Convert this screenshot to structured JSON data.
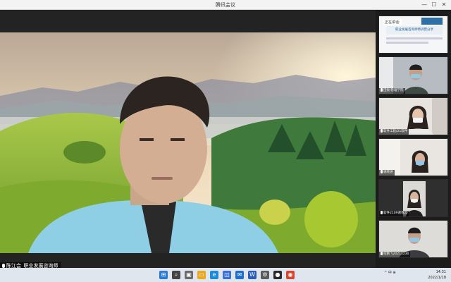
{
  "window": {
    "title": "腾讯会议",
    "min": "—",
    "max": "☐",
    "close": "✕"
  },
  "main": {
    "speaker_label": "陈江会_职业发展咨询师",
    "colors": {
      "sky_top": "#c9b7a3",
      "sky_bottom": "#f3e2c4",
      "hill_green": "#8fba3a",
      "forest": "#2e6b3a",
      "shirt": "#8fcfe6"
    }
  },
  "side": {
    "share_tile": {
      "top_text": "正在讲话:",
      "banner": "职业发展咨询师特训营分享"
    },
    "participants": [
      {
        "label": "田锐/管理学院"
      },
      {
        "label": "软件工程/21软件"
      },
      {
        "label": "谢晓涵"
      },
      {
        "label": "软件2109谢春云"
      },
      {
        "label": "何鹏飞20211230"
      }
    ]
  },
  "taskbar": {
    "icons": [
      "windows-icon",
      "search-icon",
      "files-icon",
      "explorer-icon",
      "edge-icon",
      "store-icon",
      "mail-icon",
      "word-icon",
      "settings-icon",
      "meeting-icon",
      "chrome-icon"
    ],
    "tray": "^  中  ⊕",
    "time": "14:31",
    "date": "2022/1/18"
  }
}
